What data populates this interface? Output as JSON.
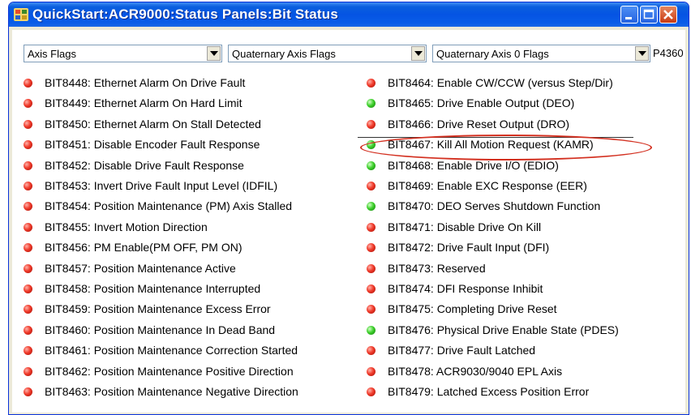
{
  "window": {
    "title": "QuickStart:ACR9000:Status Panels:Bit Status"
  },
  "selectors": {
    "group": "Axis Flags",
    "subgroup": "Quaternary Axis Flags",
    "flags": "Quaternary Axis 0 Flags",
    "parameter": "P4360"
  },
  "colors": {
    "led_off": "#e8321f",
    "led_on": "#35c824",
    "annotation": "#d33020"
  },
  "left_bits": [
    {
      "label": "BIT8448:  Ethernet Alarm On Drive Fault",
      "state": "off"
    },
    {
      "label": "BIT8449:  Ethernet Alarm On Hard Limit",
      "state": "off"
    },
    {
      "label": "BIT8450:  Ethernet Alarm On Stall Detected",
      "state": "off"
    },
    {
      "label": "BIT8451:  Disable Encoder Fault Response",
      "state": "off"
    },
    {
      "label": "BIT8452:  Disable Drive Fault Response",
      "state": "off"
    },
    {
      "label": "BIT8453:  Invert Drive Fault Input Level (IDFIL)",
      "state": "off"
    },
    {
      "label": "BIT8454:  Position Maintenance (PM) Axis Stalled",
      "state": "off"
    },
    {
      "label": "BIT8455:  Invert Motion Direction",
      "state": "off"
    },
    {
      "label": "BIT8456:  PM Enable(PM OFF, PM ON)",
      "state": "off"
    },
    {
      "label": "BIT8457:  Position Maintenance Active",
      "state": "off"
    },
    {
      "label": "BIT8458:  Position Maintenance Interrupted",
      "state": "off"
    },
    {
      "label": "BIT8459:  Position Maintenance Excess Error",
      "state": "off"
    },
    {
      "label": "BIT8460:  Position Maintenance In Dead Band",
      "state": "off"
    },
    {
      "label": "BIT8461:  Position Maintenance Correction Started",
      "state": "off"
    },
    {
      "label": "BIT8462:  Position Maintenance Positive Direction",
      "state": "off"
    },
    {
      "label": "BIT8463:  Position Maintenance Negative Direction",
      "state": "off"
    }
  ],
  "right_bits": [
    {
      "label": "BIT8464:  Enable CW/CCW (versus Step/Dir)",
      "state": "off"
    },
    {
      "label": "BIT8465:  Drive Enable Output (DEO)",
      "state": "on"
    },
    {
      "label": "BIT8466:  Drive Reset Output (DRO)",
      "state": "off"
    },
    {
      "label": "BIT8467:  Kill All Motion Request (KAMR)",
      "state": "on"
    },
    {
      "label": "BIT8468:  Enable Drive I/O (EDIO)",
      "state": "on"
    },
    {
      "label": "BIT8469:  Enable EXC Response (EER)",
      "state": "off"
    },
    {
      "label": "BIT8470:  DEO Serves Shutdown Function",
      "state": "on"
    },
    {
      "label": "BIT8471:  Disable Drive On Kill",
      "state": "off"
    },
    {
      "label": "BIT8472:  Drive Fault Input (DFI)",
      "state": "off"
    },
    {
      "label": "BIT8473:  Reserved",
      "state": "off"
    },
    {
      "label": "BIT8474:  DFI Response Inhibit",
      "state": "off"
    },
    {
      "label": "BIT8475:  Completing Drive Reset",
      "state": "off"
    },
    {
      "label": "BIT8476:  Physical Drive Enable State (PDES)",
      "state": "on"
    },
    {
      "label": "BIT8477:  Drive Fault Latched",
      "state": "off"
    },
    {
      "label": "BIT8478:  ACR9030/9040 EPL Axis",
      "state": "off"
    },
    {
      "label": "BIT8479:  Latched Excess Position Error",
      "state": "off"
    }
  ]
}
